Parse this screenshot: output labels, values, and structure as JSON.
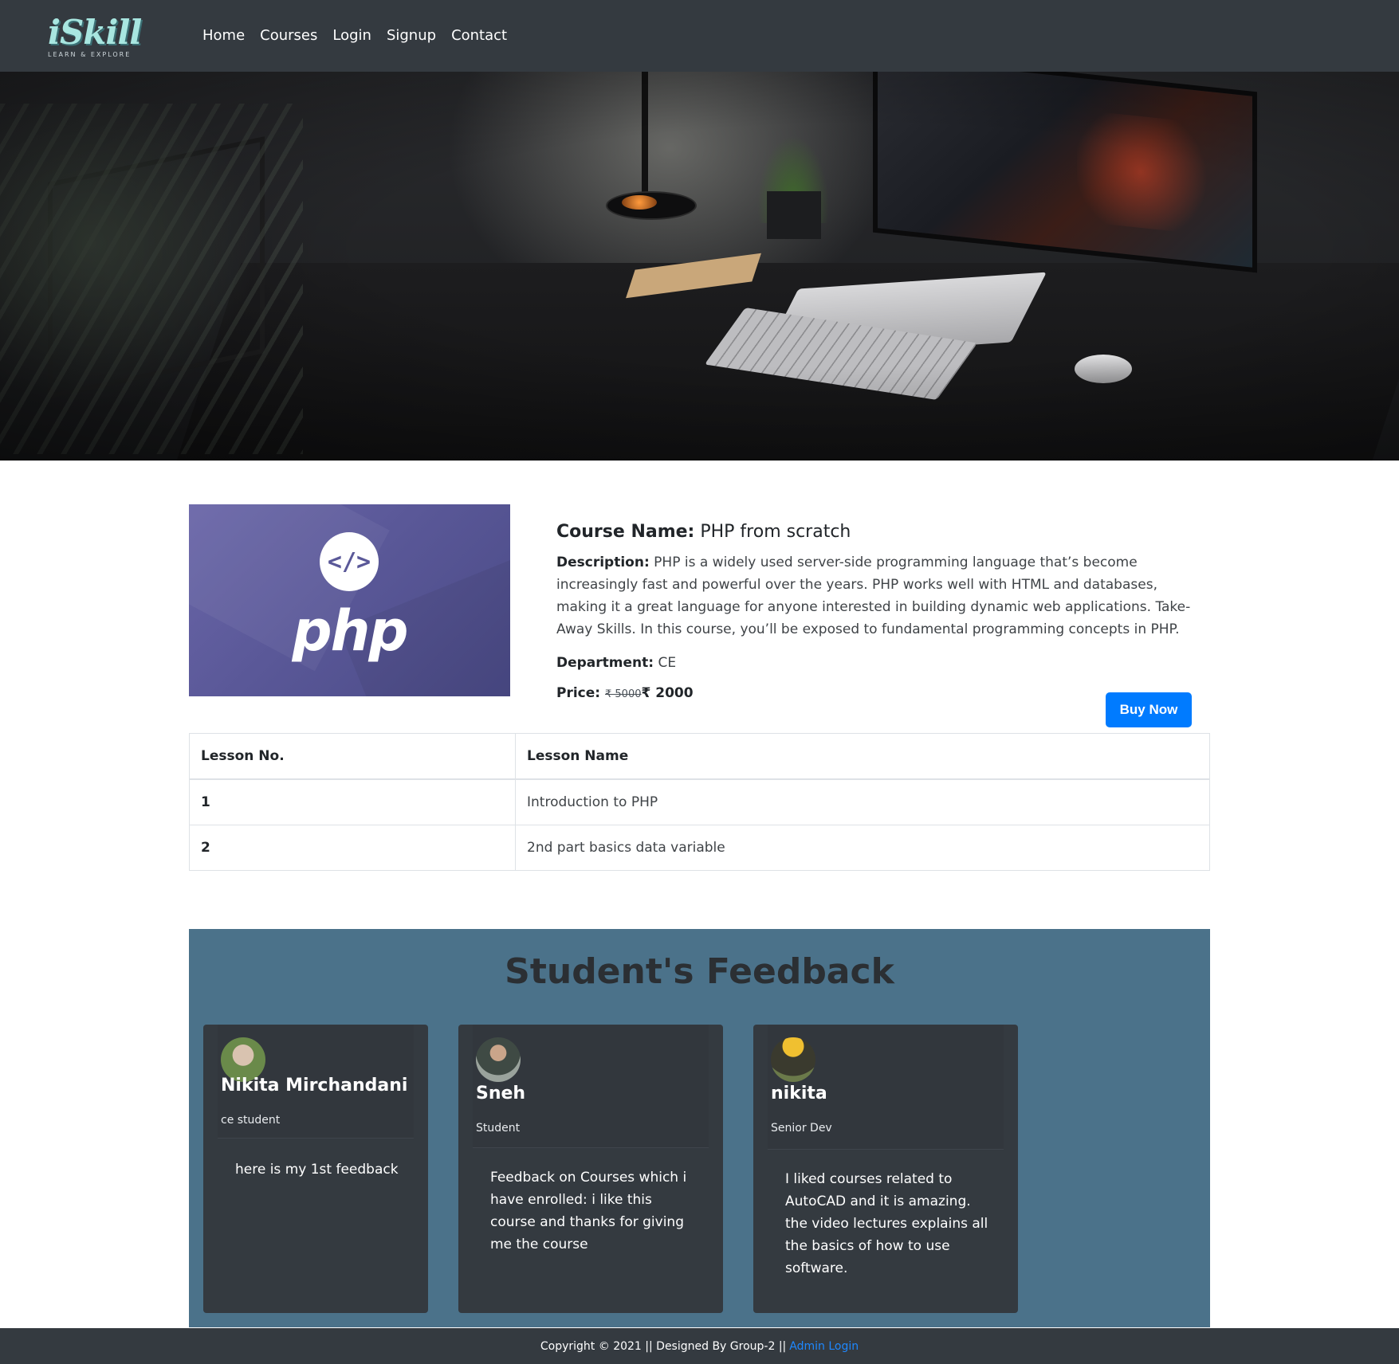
{
  "brand": {
    "name": "iSkill",
    "tagline": "LEARN & EXPLORE"
  },
  "nav": [
    "Home",
    "Courses",
    "Login",
    "Signup",
    "Contact"
  ],
  "hero": {
    "icon": "desk-setup-photo"
  },
  "course": {
    "image_text": "php",
    "image_icon": "</>",
    "name_label": "Course Name:",
    "name": "PHP from scratch",
    "description_label": "Description:",
    "description": "PHP is a widely used server-side programming language that’s become increasingly fast and powerful over the years. PHP works well with HTML and databases, making it a great language for anyone interested in building dynamic web applications. Take-Away Skills. In this course, you’ll be exposed to fundamental programming concepts in PHP.",
    "department_label": "Department:",
    "department": "CE",
    "price_label": "Price:",
    "old_price": "₹ 5000",
    "price": "₹ 2000",
    "buy_label": "Buy Now"
  },
  "lessons": {
    "headers": [
      "Lesson No.",
      "Lesson Name"
    ],
    "rows": [
      {
        "no": "1",
        "name": "Introduction to PHP"
      },
      {
        "no": "2",
        "name": "2nd part basics data variable"
      }
    ]
  },
  "feedback": {
    "title": "Student's Feedback",
    "cards": [
      {
        "name": "Nikita Mirchandani",
        "role": "ce student",
        "text": "here is my 1st feedback"
      },
      {
        "name": "Sneh",
        "role": "Student",
        "text": "Feedback on Courses which i have enrolled: i like this course and thanks for giving me the course"
      },
      {
        "name": "nikita",
        "role": "Senior Dev",
        "text": "I liked courses related to AutoCAD and it is amazing. the video lectures explains all the basics of how to use software."
      }
    ]
  },
  "footer": {
    "text": "Copyright © 2021 || Designed By Group-2 ||",
    "link": "Admin Login"
  },
  "colors": {
    "navbar": "#343a40",
    "accent": "#007bff",
    "feedback_bg": "#4b728a",
    "card_bg": "#343a40"
  }
}
